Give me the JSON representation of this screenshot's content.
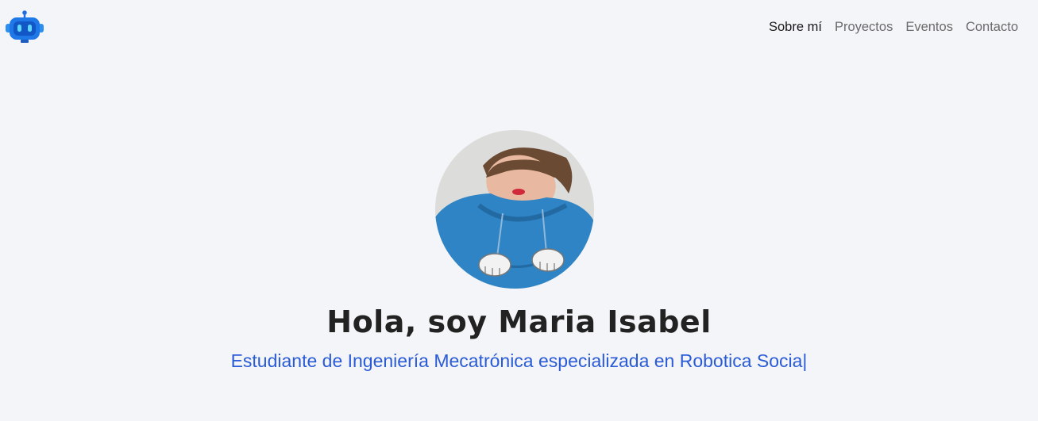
{
  "nav": {
    "logo_icon": "robot-icon",
    "links": [
      {
        "label": "Sobre mí",
        "active": true
      },
      {
        "label": "Proyectos",
        "active": false
      },
      {
        "label": "Eventos",
        "active": false
      },
      {
        "label": "Contacto",
        "active": false
      }
    ]
  },
  "hero": {
    "title": "Hola, soy Maria Isabel",
    "subtitle": "Estudiante de Ingeniería Mecatrónica especializada en Robotica Socia",
    "cursor": "|"
  },
  "colors": {
    "background": "#f4f5f8",
    "accent": "#2a5bd7",
    "text": "#222222",
    "nav_text": "#6b6b6b"
  }
}
